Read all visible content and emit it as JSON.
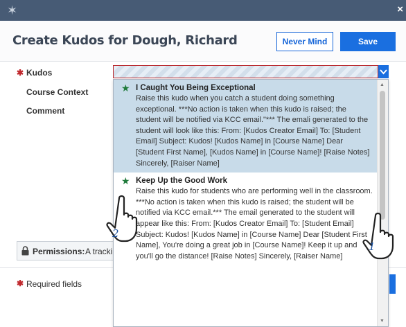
{
  "window": {
    "close_glyph": "×"
  },
  "dialog": {
    "title": "Create Kudos for Dough, Richard",
    "never_mind_label": "Never Mind",
    "save_label": "Save"
  },
  "form": {
    "kudos_label": "Kudos",
    "course_context_label": "Course Context",
    "comment_label": "Comment",
    "required_mark": "✱"
  },
  "permissions": {
    "label": "Permissions:",
    "text": "A tracki"
  },
  "footer": {
    "required_note": "Required fields"
  },
  "dropdown": {
    "items": [
      {
        "title": "I Caught You Being Exceptional",
        "description": "Raise this kudo when you catch a student doing something exceptional. ***No action is taken when this kudo is raised; the student will be notified via KCC email.\"*** The emali generated to the student will look like this: From: [Kudos Creator Email] To: [Student Email] Subject: Kudos! [Kudos Name] in [Course Name] Dear [Student First Name], [Kudos Name] in [Course Name]! [Raise Notes] Sincerely, [Raiser Name]",
        "selected": true
      },
      {
        "title": "Keep Up the Good Work",
        "description": "Raise this kudo for students who are performing well in the classroom. ***No action is taken when this kudo is raised; the student will be notified via KCC email.*** The email generated to the student will appear like this: From: [Kudos Creator Email] To: [Student Email] Subject: Kudos! [Kudos Name] in [Course Name] Dear [Student First Name], You're doing a great job in [Course Name]! Keep it up and you'll go the distance! [Raise Notes] Sincerely, [Raiser Name]",
        "selected": false
      }
    ]
  },
  "annotations": {
    "cursor_1": "1",
    "cursor_2": "2"
  },
  "colors": {
    "titlebar": "#475b75",
    "primary": "#1a6fe0",
    "required": "#c0282d",
    "selected_row": "#c8dbe9",
    "star": "#1f7a3a"
  }
}
